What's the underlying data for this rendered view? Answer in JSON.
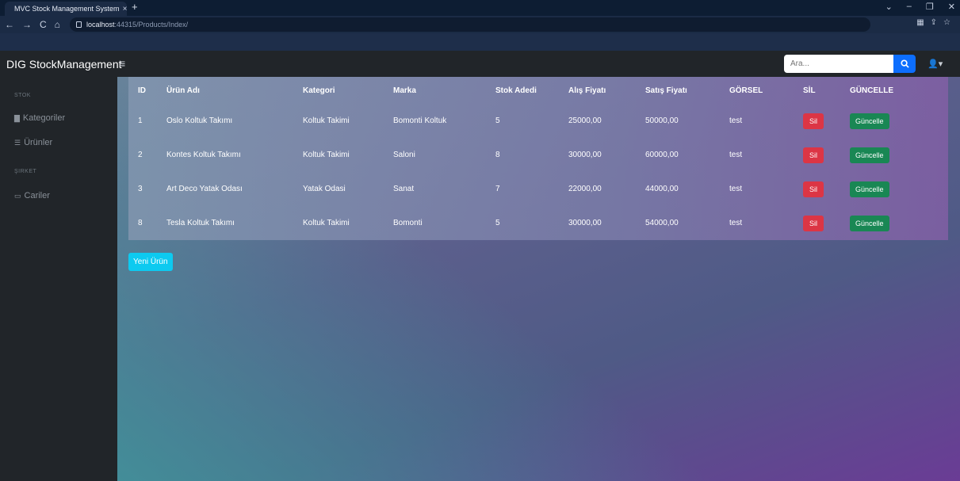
{
  "browser": {
    "tab_title": "MVC Stock Management System",
    "tab_close": "×",
    "new_tab": "+",
    "url_host": "localhost",
    "url_rest": ":44315/Products/Index/",
    "window_controls": [
      "⌄",
      "–",
      "❐",
      "✕"
    ],
    "nav": [
      "←",
      "→",
      "C",
      "⌂"
    ]
  },
  "navbar": {
    "brand": "DIG StockManagement",
    "menu_glyph": "≡",
    "search_placeholder": "Ara...",
    "user_glyph": "👤▾"
  },
  "sidebar": {
    "sections": [
      {
        "heading": "STOK",
        "items": [
          {
            "label": "Kategoriler",
            "icon": "chart-icon"
          },
          {
            "label": "Ürünler",
            "icon": "list-icon"
          }
        ]
      },
      {
        "heading": "ŞIRKET",
        "items": [
          {
            "label": "Cariler",
            "icon": "card-icon"
          }
        ]
      }
    ]
  },
  "table": {
    "headers": [
      "ID",
      "Ürün Adı",
      "Kategori",
      "Marka",
      "Stok Adedi",
      "Alış Fiyatı",
      "Satış Fiyatı",
      "GÖRSEL",
      "SİL",
      "GÜNCELLE"
    ],
    "rows": [
      {
        "id": "1",
        "name": "Oslo Koltuk Takımı",
        "category": "Koltuk Takimi",
        "brand": "Bomonti Koltuk",
        "stock": "5",
        "buy": "25000,00",
        "sell": "50000,00",
        "image": "test"
      },
      {
        "id": "2",
        "name": "Kontes Koltuk Takımı",
        "category": "Koltuk Takimi",
        "brand": "Saloni",
        "stock": "8",
        "buy": "30000,00",
        "sell": "60000,00",
        "image": "test"
      },
      {
        "id": "3",
        "name": "Art Deco Yatak Odası",
        "category": "Yatak Odasi",
        "brand": "Sanat",
        "stock": "7",
        "buy": "22000,00",
        "sell": "44000,00",
        "image": "test"
      },
      {
        "id": "8",
        "name": "Tesla Koltuk Takımı",
        "category": "Koltuk Takimi",
        "brand": "Bomonti",
        "stock": "5",
        "buy": "30000,00",
        "sell": "54000,00",
        "image": "test"
      }
    ],
    "delete_label": "Sil",
    "update_label": "Güncelle"
  },
  "new_product_label": "Yeni Ürün",
  "colors": {
    "navbar": "#212529",
    "search_button": "#0d6efd",
    "delete_button": "#dc3545",
    "update_button": "#198754",
    "new_button": "#0dcaf0"
  }
}
